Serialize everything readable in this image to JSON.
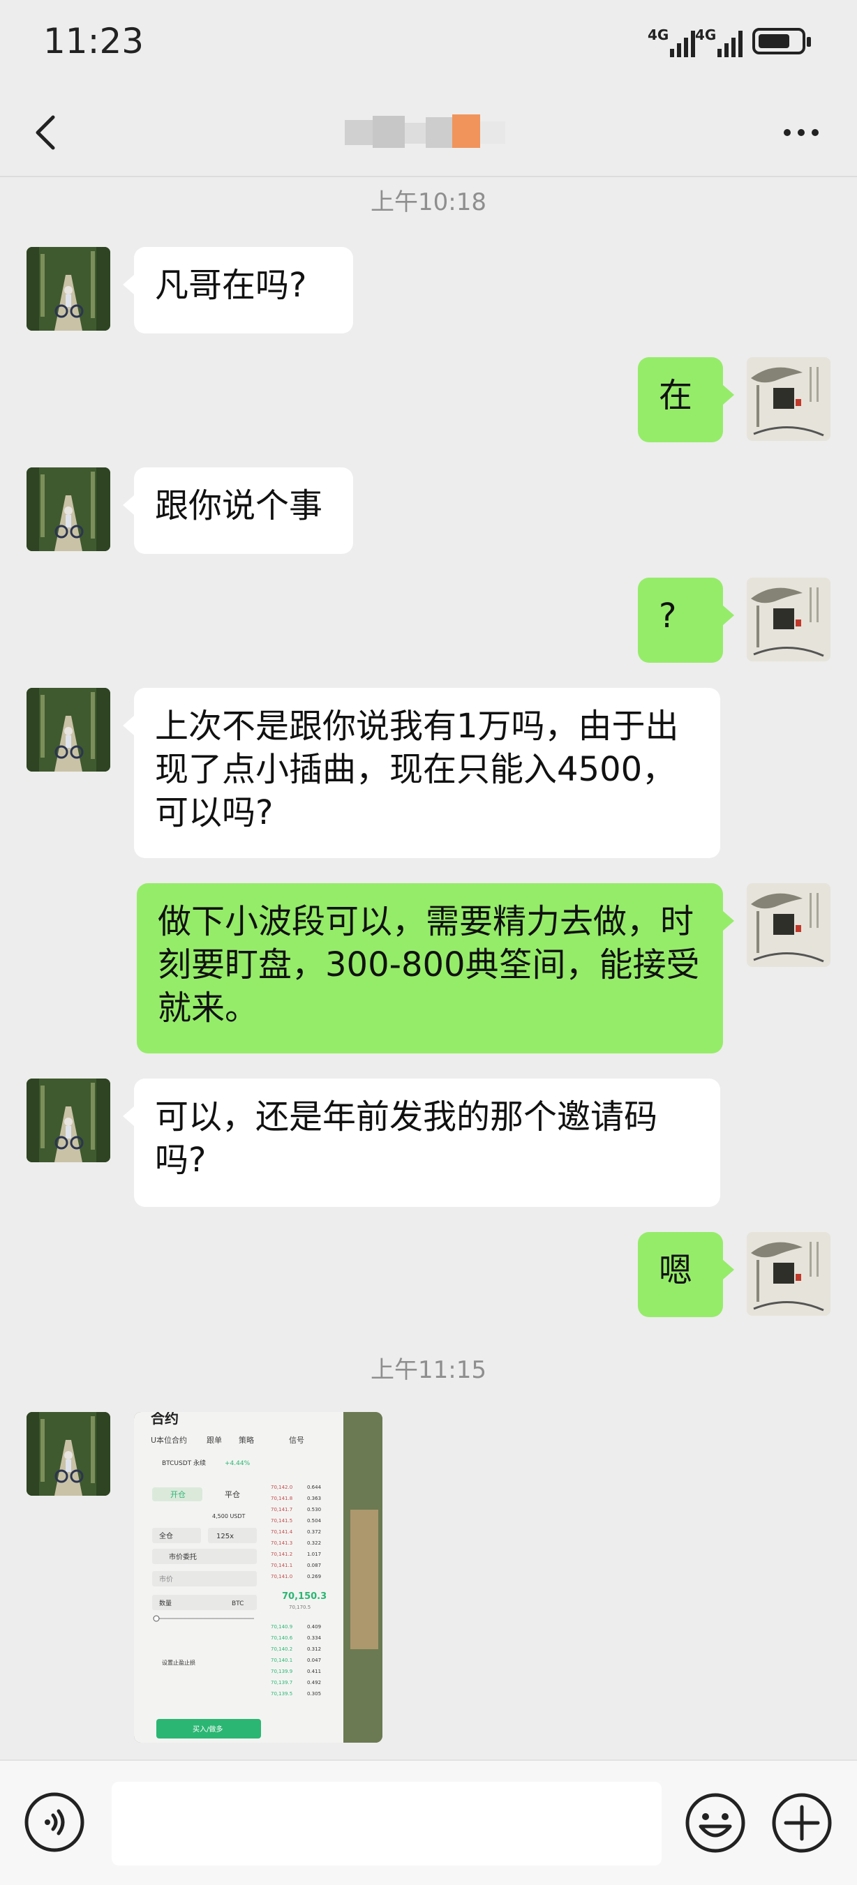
{
  "status_bar": {
    "time": "11:23",
    "network_1": "4G",
    "network_2": "4G"
  },
  "header": {
    "title": ""
  },
  "timestamps": [
    "上午10:18",
    "上午11:15"
  ],
  "messages": [
    {
      "side": "left",
      "text": "凡哥在吗?"
    },
    {
      "side": "right",
      "text": "在"
    },
    {
      "side": "left",
      "text": "跟你说个事"
    },
    {
      "side": "right",
      "text": "?"
    },
    {
      "side": "left",
      "text": "上次不是跟你说我有1万吗，由于出现了点小插曲，现在只能入4500，可以吗?"
    },
    {
      "side": "right",
      "text": "做下小波段可以，需要精力去做，时刻要盯盘，300-800典筌间，能接受就来。"
    },
    {
      "side": "left",
      "text": "可以，还是年前发我的那个邀请码吗?"
    },
    {
      "side": "right",
      "text": "嗯"
    }
  ],
  "image_message": {
    "title": "合约",
    "tabs": [
      "U本位合约",
      "跟单",
      "策略",
      "信号"
    ],
    "pair": "BTCUSDT 永续",
    "change": "+4.44%",
    "open_label": "开仓",
    "close_label": "平仓",
    "available": "4,500 USDT",
    "margin_mode": "全仓",
    "leverage": "125x",
    "order_type": "市价委托",
    "price_placeholder": "市价",
    "qty_label": "数量",
    "qty_unit": "BTC",
    "tp_sl_label": "设置止盈止损",
    "buy_label": "买入/做多",
    "mid_price": "70,150.3",
    "mid_sub": "70,170.5",
    "asks": [
      [
        "70,142.0",
        "0.644"
      ],
      [
        "70,141.8",
        "0.363"
      ],
      [
        "70,141.7",
        "0.530"
      ],
      [
        "70,141.5",
        "0.504"
      ],
      [
        "70,141.4",
        "0.372"
      ],
      [
        "70,141.3",
        "0.322"
      ],
      [
        "70,141.2",
        "1.017"
      ],
      [
        "70,141.1",
        "0.087"
      ],
      [
        "70,141.0",
        "0.269"
      ]
    ],
    "bids": [
      [
        "70,140.9",
        "0.409"
      ],
      [
        "70,140.6",
        "0.334"
      ],
      [
        "70,140.2",
        "0.312"
      ],
      [
        "70,140.1",
        "0.047"
      ],
      [
        "70,139.9",
        "0.411"
      ],
      [
        "70,139.7",
        "0.492"
      ],
      [
        "70,139.5",
        "0.305"
      ]
    ]
  },
  "input_bar": {
    "placeholder": ""
  },
  "colors": {
    "background": "#ededed",
    "bubble_self": "#95ec69",
    "bubble_other": "#ffffff",
    "timestamp": "#8e8e8e"
  }
}
